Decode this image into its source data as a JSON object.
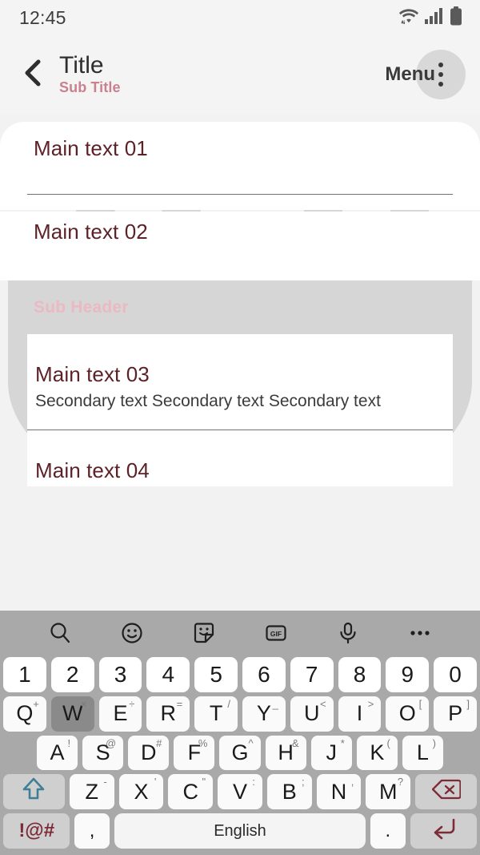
{
  "status_bar": {
    "time": "12:45",
    "icons": [
      "wifi-icon",
      "cellular-signal-icon",
      "battery-icon"
    ]
  },
  "app_bar": {
    "back_icon": "back-chevron-icon",
    "title": "Title",
    "subtitle": "Sub Title",
    "menu_label": "Menu",
    "menu_icon": "overflow-menu-icon"
  },
  "colors": {
    "background": "#f4f4f4",
    "card": "#ffffff",
    "main_text": "#5d2228",
    "secondary_text": "#3b3b3b",
    "subtitle": "#c9808f",
    "sub_header": "#eab9c4",
    "keyboard_bg": "#a9a9a9",
    "key_bg": "#fafafa",
    "key_pressed": "#8a8a8a",
    "accent_red": "#7d2b37",
    "shift_blue": "#3f7f95",
    "watermark_gray": "#d6d6d6",
    "watermark_pink": "#f6dde2"
  },
  "list": {
    "items": [
      {
        "main": "Main text 01",
        "secondary": ""
      },
      {
        "main": "Main text 02",
        "secondary": ""
      },
      {
        "main": "Main text 03",
        "secondary": "Secondary text Secondary text Secondary text"
      },
      {
        "main": "Main text 04",
        "secondary": ""
      }
    ],
    "sub_header": "Sub Header"
  },
  "keyboard": {
    "toolbar": [
      {
        "name": "search-icon",
        "label": "search"
      },
      {
        "name": "emoji-icon",
        "label": "emoji"
      },
      {
        "name": "sticker-icon",
        "label": "sticker"
      },
      {
        "name": "gif-icon",
        "label": "GIF"
      },
      {
        "name": "microphone-icon",
        "label": "voice input"
      },
      {
        "name": "more-options-icon",
        "label": "more"
      }
    ],
    "row_numbers": [
      {
        "key": "1"
      },
      {
        "key": "2"
      },
      {
        "key": "3"
      },
      {
        "key": "4"
      },
      {
        "key": "5"
      },
      {
        "key": "6"
      },
      {
        "key": "7"
      },
      {
        "key": "8"
      },
      {
        "key": "9"
      },
      {
        "key": "0"
      }
    ],
    "row_qwerty": [
      {
        "key": "Q",
        "sup": "+",
        "pressed": false
      },
      {
        "key": "W",
        "sup": "×",
        "pressed": true
      },
      {
        "key": "E",
        "sup": "÷",
        "pressed": false
      },
      {
        "key": "R",
        "sup": "=",
        "pressed": false
      },
      {
        "key": "T",
        "sup": "/",
        "pressed": false
      },
      {
        "key": "Y",
        "sup": "_",
        "pressed": false
      },
      {
        "key": "U",
        "sup": "<",
        "pressed": false
      },
      {
        "key": "I",
        "sup": ">",
        "pressed": false
      },
      {
        "key": "O",
        "sup": "[",
        "pressed": false
      },
      {
        "key": "P",
        "sup": "]",
        "pressed": false
      }
    ],
    "row_asdf": [
      {
        "key": "A",
        "sup": "!"
      },
      {
        "key": "S",
        "sup": "@"
      },
      {
        "key": "D",
        "sup": "#"
      },
      {
        "key": "F",
        "sup": "%"
      },
      {
        "key": "G",
        "sup": "^"
      },
      {
        "key": "H",
        "sup": "&"
      },
      {
        "key": "J",
        "sup": "*"
      },
      {
        "key": "K",
        "sup": "("
      },
      {
        "key": "L",
        "sup": ")"
      }
    ],
    "row_zxcv": [
      {
        "key": "Z",
        "sup": "-"
      },
      {
        "key": "X",
        "sup": "'"
      },
      {
        "key": "C",
        "sup": "\""
      },
      {
        "key": "V",
        "sup": ":"
      },
      {
        "key": "B",
        "sup": ";"
      },
      {
        "key": "N",
        "sup": ","
      },
      {
        "key": "M",
        "sup": "?"
      }
    ],
    "shift_key": "shift-icon",
    "backspace_key": "backspace-icon",
    "symbols_key": "!@#",
    "comma_key": ",",
    "space_key": "English",
    "period_key": ".",
    "enter_key": "enter-icon"
  }
}
